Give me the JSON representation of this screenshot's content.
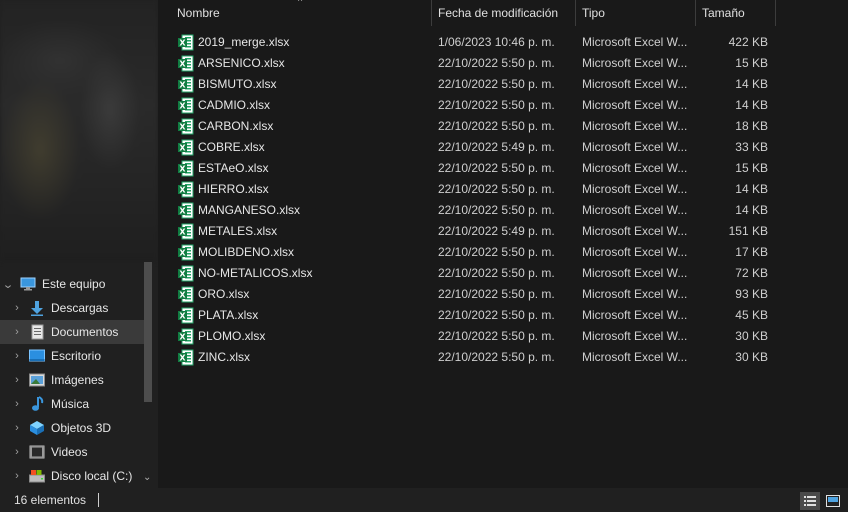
{
  "nav": {
    "items": [
      {
        "label": "Este equipo",
        "icon": "computer-icon",
        "chevron": "⌄",
        "expanded": true,
        "indent": 0
      },
      {
        "label": "Descargas",
        "icon": "downloads-icon",
        "chevron": "›",
        "indent": 1
      },
      {
        "label": "Documentos",
        "icon": "documents-icon",
        "chevron": "›",
        "indent": 1,
        "selected": true
      },
      {
        "label": "Escritorio",
        "icon": "desktop-icon",
        "chevron": "›",
        "indent": 1
      },
      {
        "label": "Imágenes",
        "icon": "pictures-icon",
        "chevron": "›",
        "indent": 1
      },
      {
        "label": "Música",
        "icon": "music-icon",
        "chevron": "›",
        "indent": 1
      },
      {
        "label": "Objetos 3D",
        "icon": "3d-objects-icon",
        "chevron": "›",
        "indent": 1
      },
      {
        "label": "Videos",
        "icon": "videos-icon",
        "chevron": "›",
        "indent": 1
      },
      {
        "label": "Disco local (C:)",
        "icon": "local-disk-icon",
        "chevron": "›",
        "indent": 1
      }
    ]
  },
  "columns": {
    "name": "Nombre",
    "date": "Fecha de modificación",
    "type": "Tipo",
    "size": "Tamaño"
  },
  "files": [
    {
      "name": "2019_merge.xlsx",
      "date": "1/06/2023 10:46 p. m.",
      "type": "Microsoft Excel W...",
      "size": "422 KB"
    },
    {
      "name": "ARSENICO.xlsx",
      "date": "22/10/2022 5:50 p. m.",
      "type": "Microsoft Excel W...",
      "size": "15 KB"
    },
    {
      "name": "BISMUTO.xlsx",
      "date": "22/10/2022 5:50 p. m.",
      "type": "Microsoft Excel W...",
      "size": "14 KB"
    },
    {
      "name": "CADMIO.xlsx",
      "date": "22/10/2022 5:50 p. m.",
      "type": "Microsoft Excel W...",
      "size": "14 KB"
    },
    {
      "name": "CARBON.xlsx",
      "date": "22/10/2022 5:50 p. m.",
      "type": "Microsoft Excel W...",
      "size": "18 KB"
    },
    {
      "name": "COBRE.xlsx",
      "date": "22/10/2022 5:49 p. m.",
      "type": "Microsoft Excel W...",
      "size": "33 KB"
    },
    {
      "name": "ESTAeO.xlsx",
      "date": "22/10/2022 5:50 p. m.",
      "type": "Microsoft Excel W...",
      "size": "15 KB"
    },
    {
      "name": "HIERRO.xlsx",
      "date": "22/10/2022 5:50 p. m.",
      "type": "Microsoft Excel W...",
      "size": "14 KB"
    },
    {
      "name": "MANGANESO.xlsx",
      "date": "22/10/2022 5:50 p. m.",
      "type": "Microsoft Excel W...",
      "size": "14 KB"
    },
    {
      "name": "METALES.xlsx",
      "date": "22/10/2022 5:49 p. m.",
      "type": "Microsoft Excel W...",
      "size": "151 KB"
    },
    {
      "name": "MOLIBDENO.xlsx",
      "date": "22/10/2022 5:50 p. m.",
      "type": "Microsoft Excel W...",
      "size": "17 KB"
    },
    {
      "name": "NO-METALICOS.xlsx",
      "date": "22/10/2022 5:50 p. m.",
      "type": "Microsoft Excel W...",
      "size": "72 KB"
    },
    {
      "name": "ORO.xlsx",
      "date": "22/10/2022 5:50 p. m.",
      "type": "Microsoft Excel W...",
      "size": "93 KB"
    },
    {
      "name": "PLATA.xlsx",
      "date": "22/10/2022 5:50 p. m.",
      "type": "Microsoft Excel W...",
      "size": "45 KB"
    },
    {
      "name": "PLOMO.xlsx",
      "date": "22/10/2022 5:50 p. m.",
      "type": "Microsoft Excel W...",
      "size": "30 KB"
    },
    {
      "name": "ZINC.xlsx",
      "date": "22/10/2022 5:50 p. m.",
      "type": "Microsoft Excel W...",
      "size": "30 KB"
    }
  ],
  "file_icon": "excel-file-icon",
  "status": {
    "count": "16 elementos"
  },
  "view_buttons": {
    "details_icon": "details-view-icon",
    "tiles_icon": "large-icons-view-icon"
  },
  "colors": {
    "background": "#191919",
    "nav_background": "#202020",
    "excel_green": "#21a366",
    "selected": "#3a3a3a"
  }
}
